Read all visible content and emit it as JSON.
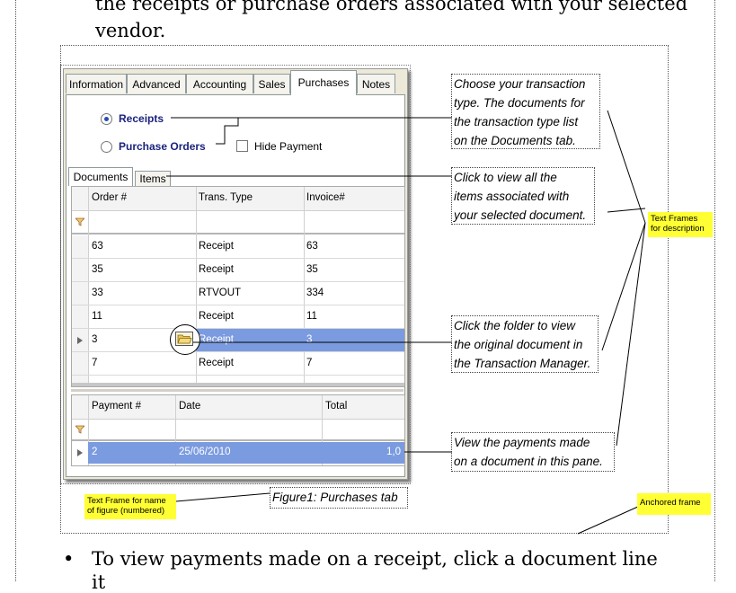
{
  "page": {
    "top_text_line1": "the receipts or purchase orders associated with your selected",
    "top_text_line2": "vendor.",
    "bullet_symbol": "•",
    "bottom_text": "To view payments made on a receipt, click a document line",
    "bottom_text_cut": "it"
  },
  "window": {
    "tabs": [
      "Information",
      "Advanced",
      "Accounting",
      "Sales",
      "Purchases",
      "Notes"
    ],
    "active_tab": "Purchases",
    "radio_receipts": "Receipts",
    "radio_purchase_orders": "Purchase Orders",
    "hide_payment": "Hide Payment",
    "subtabs": [
      "Documents",
      "Items"
    ],
    "doc_columns": [
      "Order #",
      "Trans. Type",
      "Invoice#"
    ],
    "doc_rows": [
      [
        "63",
        "Receipt",
        "63"
      ],
      [
        "35",
        "Receipt",
        "35"
      ],
      [
        "33",
        "RTVOUT",
        "334"
      ],
      [
        "11",
        "Receipt",
        "11"
      ],
      [
        "3",
        "Receipt",
        "3"
      ],
      [
        "7",
        "Receipt",
        "7"
      ]
    ],
    "selected_doc_row": 4,
    "pay_columns": [
      "Payment #",
      "Date",
      "Total"
    ],
    "pay_rows": [
      [
        "2",
        "25/06/2010",
        "1,0"
      ]
    ],
    "filter_icon": "funnel-icon",
    "row_pointer_icon": "triangle-right-icon",
    "folder_icon": "open-folder-icon",
    "selection_color": "#7b9be0"
  },
  "callouts": {
    "transaction_type": [
      "Choose your transaction",
      "type. The documents for",
      "the transaction type list",
      "on the Documents tab."
    ],
    "items": [
      "Click to view all the",
      "items associated with",
      "your selected document."
    ],
    "folder": [
      "Click the folder to view",
      "the original document in",
      "the Transaction Manager."
    ],
    "payments": [
      "View the payments made",
      "on a document in this pane."
    ],
    "figure_caption": "Figure1: Purchases tab"
  },
  "notes": {
    "text_frames": [
      "Text Frames",
      "for description"
    ],
    "figure_name": [
      "Text Frame for name",
      "of figure (numbered)"
    ],
    "anchored_frame": "Anchored frame"
  }
}
